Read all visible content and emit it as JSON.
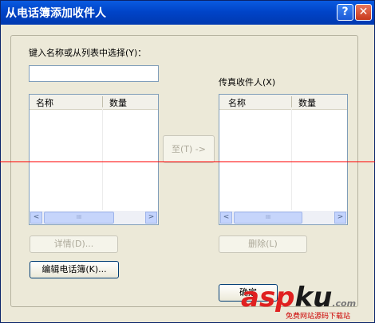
{
  "window": {
    "title": "从电话簿添加收件人"
  },
  "titlebar_icons": {
    "help": "?",
    "close": "✕"
  },
  "search": {
    "label": "键入名称或从列表中选择(Y)：",
    "value": ""
  },
  "left_list": {
    "columns": [
      "名称",
      "数量"
    ],
    "rows": []
  },
  "right_list": {
    "label": "传真收件人(X)",
    "columns": [
      "名称",
      "数量"
    ],
    "rows": []
  },
  "scrollbar": {
    "left_arrow": "<",
    "right_arrow": ">",
    "grip": "III"
  },
  "buttons": {
    "to": "至(T) ->",
    "details": "详情(D)...",
    "delete": "删除(L)",
    "edit_phonebook": "编辑电话簿(K)...",
    "ok": "确定"
  },
  "watermark": {
    "brand_a": "asp",
    "brand_b": "ku",
    "suffix": ".com",
    "tagline": "免费网站源码下载站"
  }
}
